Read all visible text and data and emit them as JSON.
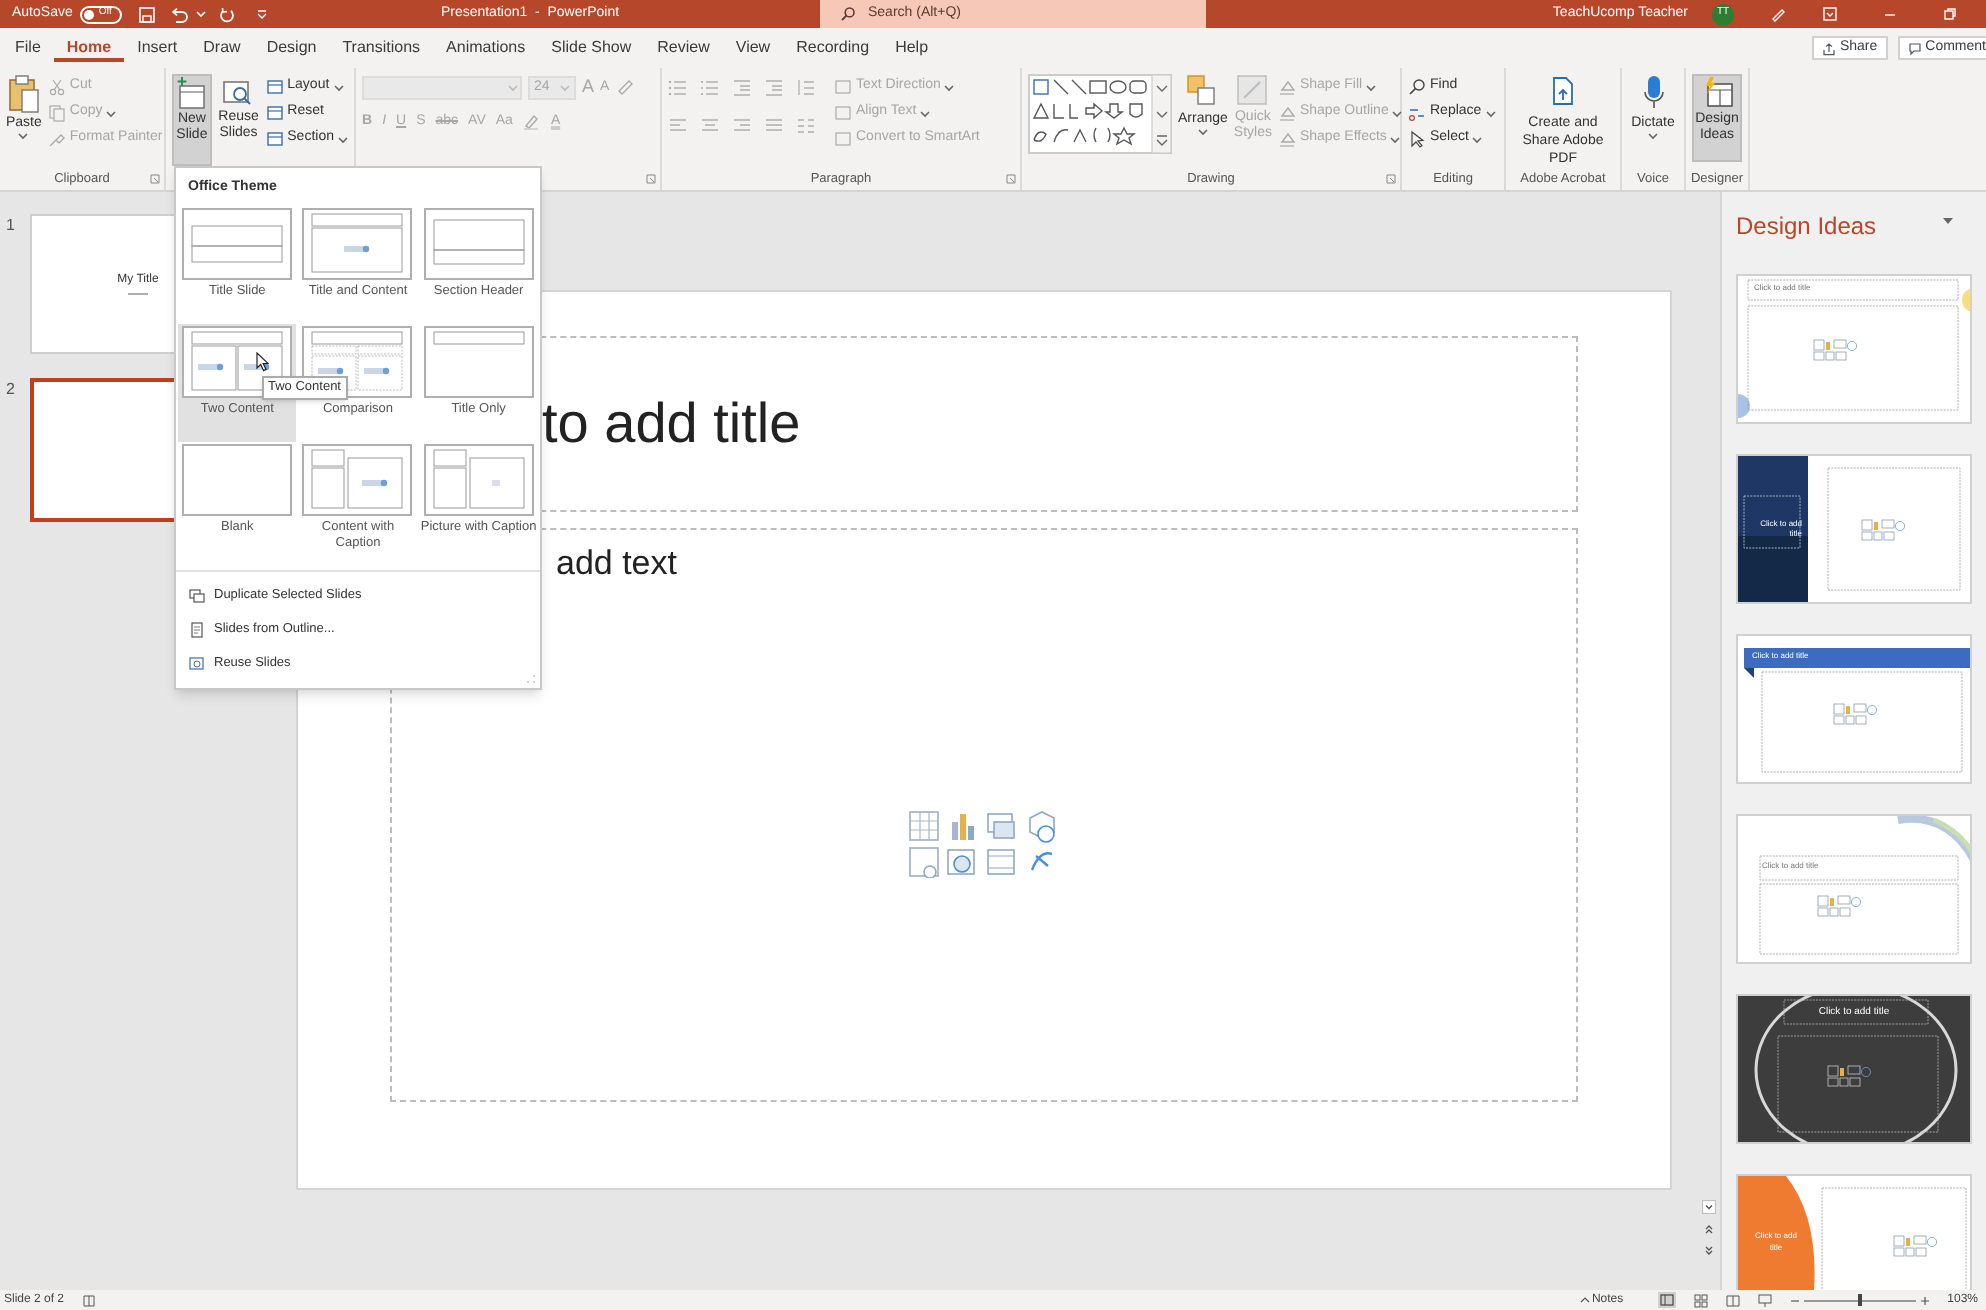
{
  "title_bar": {
    "autosave": {
      "label": "AutoSave",
      "state_text": "Off",
      "on": false
    },
    "title": "Presentation1  -  PowerPoint",
    "search": {
      "placeholder": "Search (Alt+Q)"
    },
    "user": {
      "name": "TeachUcomp Teacher",
      "initials": "TT"
    }
  },
  "tabs": [
    {
      "label": "File",
      "selected": false
    },
    {
      "label": "Home",
      "selected": true
    },
    {
      "label": "Insert",
      "selected": false
    },
    {
      "label": "Draw",
      "selected": false
    },
    {
      "label": "Design",
      "selected": false
    },
    {
      "label": "Transitions",
      "selected": false
    },
    {
      "label": "Animations",
      "selected": false
    },
    {
      "label": "Slide Show",
      "selected": false
    },
    {
      "label": "Review",
      "selected": false
    },
    {
      "label": "View",
      "selected": false
    },
    {
      "label": "Recording",
      "selected": false
    },
    {
      "label": "Help",
      "selected": false
    }
  ],
  "share": "Share",
  "comments": "Comment",
  "ribbon": {
    "clipboard": {
      "label": "Clipboard",
      "paste": "Paste",
      "items": [
        {
          "label": "Cut",
          "disabled": true
        },
        {
          "label": "Copy",
          "disabled": true
        },
        {
          "label": "Format Painter",
          "disabled": true
        }
      ]
    },
    "slides": {
      "new_slide": {
        "label": "New Slide",
        "pressed": true
      },
      "reuse": "Reuse Slides",
      "items": [
        "Layout",
        "Reset",
        "Section"
      ]
    },
    "font": {
      "disabled": true,
      "size": "24",
      "size_buttons": [
        "A",
        "A"
      ],
      "buttons": [
        "B",
        "I",
        "U",
        "S",
        "abc",
        "AV",
        "Aa"
      ],
      "color_button": "A"
    },
    "paragraph": {
      "label": "Paragraph",
      "disabled": true,
      "items": [
        "Text Direction",
        "Align Text",
        "Convert to SmartArt"
      ]
    },
    "drawing": {
      "label": "Drawing",
      "arrange": "Arrange",
      "quick_styles": {
        "label": "Quick Styles",
        "disabled": true
      },
      "items": [
        {
          "label": "Shape Fill",
          "disabled": true
        },
        {
          "label": "Shape Outline",
          "disabled": true
        },
        {
          "label": "Shape Effects",
          "disabled": true
        }
      ]
    },
    "editing": {
      "label": "Editing",
      "items": [
        "Find",
        "Replace",
        "Select"
      ]
    },
    "acrobat": {
      "label": "Adobe Acrobat",
      "button": "Create and Share Adobe PDF"
    },
    "voice": {
      "label": "Voice",
      "button": "Dictate"
    },
    "designer": {
      "label": "Designer",
      "button": "Design Ideas",
      "pressed": true
    }
  },
  "slide_panel": {
    "slides": [
      {
        "number": "1",
        "title": "My Title",
        "selected": false
      },
      {
        "number": "2",
        "selected": true
      }
    ]
  },
  "slide": {
    "title_placeholder": "to add title",
    "body_placeholder": "add text"
  },
  "new_slide_menu": {
    "heading": "Office Theme",
    "layouts": [
      {
        "kind": "title",
        "label": "Title Slide",
        "hovered": false
      },
      {
        "kind": "title-content",
        "label": "Title and Content",
        "hovered": false
      },
      {
        "kind": "section",
        "label": "Section Header",
        "hovered": false
      },
      {
        "kind": "two-content",
        "label": "Two Content",
        "hovered": true
      },
      {
        "kind": "comparison",
        "label": "Comparison",
        "hovered": false
      },
      {
        "kind": "title-only",
        "label": "Title Only",
        "hovered": false
      },
      {
        "kind": "blank",
        "label": "Blank",
        "hovered": false
      },
      {
        "kind": "content-caption",
        "label": "Content with Caption",
        "hovered": false
      },
      {
        "kind": "picture-caption",
        "label": "Picture with Caption",
        "hovered": false
      }
    ],
    "tooltip": "Two Content",
    "commands": [
      "Duplicate Selected Slides",
      "Slides from Outline...",
      "Reuse Slides"
    ]
  },
  "design_ideas": {
    "title": "Design Ideas",
    "ideas": [
      {
        "kind": "plain",
        "title": "Click to add title"
      },
      {
        "kind": "navy",
        "title": "Click to add title"
      },
      {
        "kind": "banner",
        "title": "Click to add title"
      },
      {
        "kind": "arc",
        "title": "Click to add title"
      },
      {
        "kind": "dark",
        "title": "Click to add title"
      },
      {
        "kind": "orange",
        "title": "Click to add title"
      }
    ]
  },
  "status_bar": {
    "slide_info": "Slide 2 of 2",
    "notes": "Notes",
    "zoom": {
      "level": 0.5
    },
    "zoom_text": "103%"
  }
}
